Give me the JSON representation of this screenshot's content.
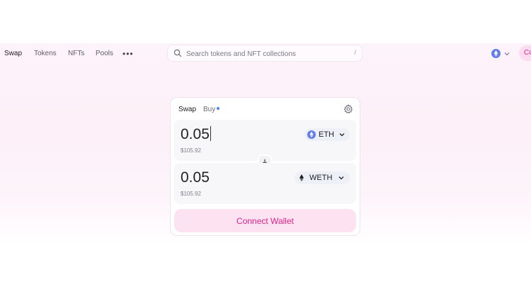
{
  "nav": {
    "items": [
      {
        "label": "Swap"
      },
      {
        "label": "Tokens"
      },
      {
        "label": "NFTs"
      },
      {
        "label": "Pools"
      }
    ],
    "more_icon": "ellipsis-icon"
  },
  "search": {
    "placeholder": "Search tokens and NFT collections",
    "shortcut": "/"
  },
  "header": {
    "chain_icon": "ethereum-icon",
    "connect_label_visible": "Co"
  },
  "swap_card": {
    "tabs": [
      {
        "label": "Swap"
      },
      {
        "label": "Buy"
      }
    ],
    "settings_icon": "gear-icon",
    "input": {
      "amount": "0.05",
      "usd_value": "$105.92",
      "token": "ETH"
    },
    "output": {
      "amount": "0.05",
      "usd_value": "$105.92",
      "token": "WETH"
    },
    "switch_icon": "arrow-down-icon",
    "connect_wallet_label": "Connect Wallet"
  },
  "colors": {
    "accent_pink": "#e0218a",
    "buy_dot": "#4c82fb",
    "eth_blue": "#627eea"
  }
}
